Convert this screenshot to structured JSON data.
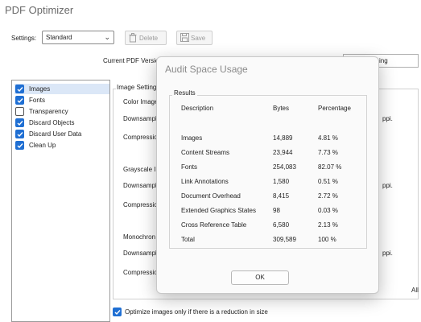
{
  "window": {
    "title": "PDF Optimizer"
  },
  "toolbar": {
    "settings_label": "Settings:",
    "settings_value": "Standard",
    "delete_label": "Delete",
    "save_label": "Save"
  },
  "current_version_label": "Current PDF Version",
  "right_field_value": "ing",
  "sidebar": {
    "items": [
      {
        "label": "Images",
        "checked": true
      },
      {
        "label": "Fonts",
        "checked": true
      },
      {
        "label": "Transparency",
        "checked": false
      },
      {
        "label": "Discard Objects",
        "checked": true
      },
      {
        "label": "Discard User Data",
        "checked": true
      },
      {
        "label": "Clean Up",
        "checked": true
      }
    ]
  },
  "image_settings": {
    "group_label": "Image Settings",
    "color_images": "Color Image",
    "downsample_1": "Downsampl",
    "compression_1": "Compressio",
    "grayscale": "Grayscale In",
    "downsample_2": "Downsampl",
    "compression_2": "Compressio",
    "monochrome": "Monochron",
    "downsample_3": "Downsampl",
    "compression_3": "Compressio",
    "ppi_1": "ppi.",
    "ppi_2": "ppi.",
    "ppi_3": "ppi.",
    "all_partial": "All"
  },
  "optimize_checkbox": {
    "label": "Optimize images only if there is a reduction in size",
    "checked": true
  },
  "dialog": {
    "title": "Audit Space Usage",
    "results_label": "Results",
    "columns": [
      "Description",
      "Bytes",
      "Percentage"
    ],
    "rows": [
      {
        "description": "Images",
        "bytes": "14,889",
        "percentage": "4.81 %"
      },
      {
        "description": "Content Streams",
        "bytes": "23,944",
        "percentage": "7.73 %"
      },
      {
        "description": "Fonts",
        "bytes": "254,083",
        "percentage": "82.07 %"
      },
      {
        "description": "Link Annotations",
        "bytes": "1,580",
        "percentage": "0.51 %"
      },
      {
        "description": "Document Overhead",
        "bytes": "8,415",
        "percentage": "2.72 %"
      },
      {
        "description": "Extended Graphics States",
        "bytes": "98",
        "percentage": "0.03 %"
      },
      {
        "description": "Cross Reference Table",
        "bytes": "6,580",
        "percentage": "2.13 %"
      },
      {
        "description": "Total",
        "bytes": "309,589",
        "percentage": "100 %"
      }
    ],
    "ok_label": "OK"
  },
  "colors": {
    "accent": "#1f6fd3",
    "selection": "#dbe7f7"
  }
}
